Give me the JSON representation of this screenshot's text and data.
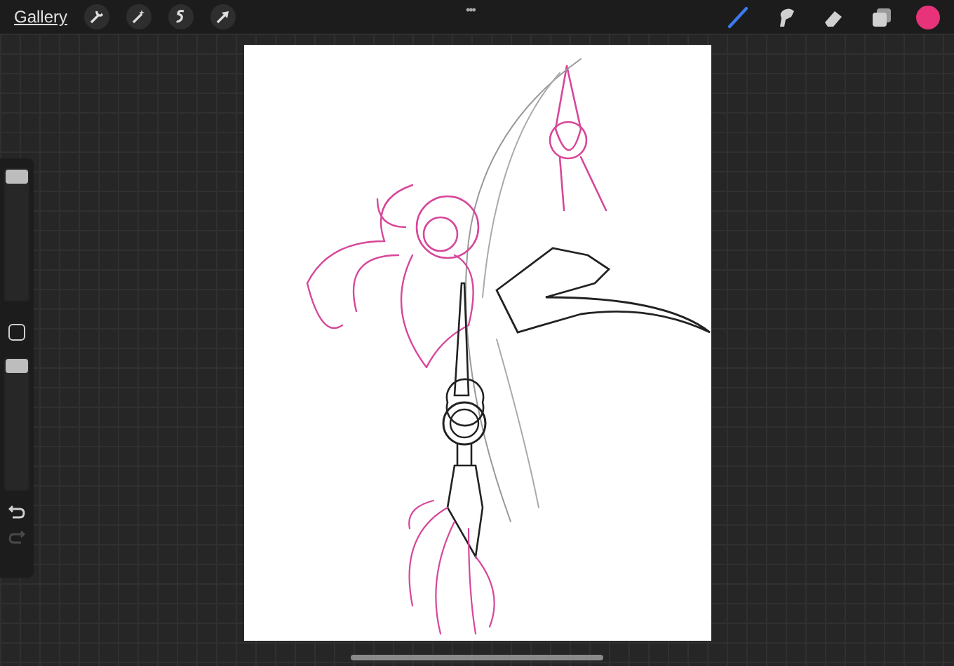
{
  "toolbar": {
    "gallery": "Gallery",
    "actions": [
      {
        "kind": "wrench"
      },
      {
        "kind": "wand"
      },
      {
        "kind": "selection"
      },
      {
        "kind": "transform"
      }
    ],
    "more": "•••",
    "tools": [
      {
        "kind": "brush",
        "selected": true
      },
      {
        "kind": "smudge",
        "selected": false
      },
      {
        "kind": "eraser",
        "selected": false
      },
      {
        "kind": "layers",
        "selected": false
      }
    ],
    "color": {
      "color": "#e8337a"
    }
  },
  "sidebar": {
    "brush_size": {
      "level": 1.0
    },
    "opacity": {
      "level": 1.0
    },
    "undo": {
      "disabled": false
    },
    "redo": {
      "disabled": true
    }
  }
}
